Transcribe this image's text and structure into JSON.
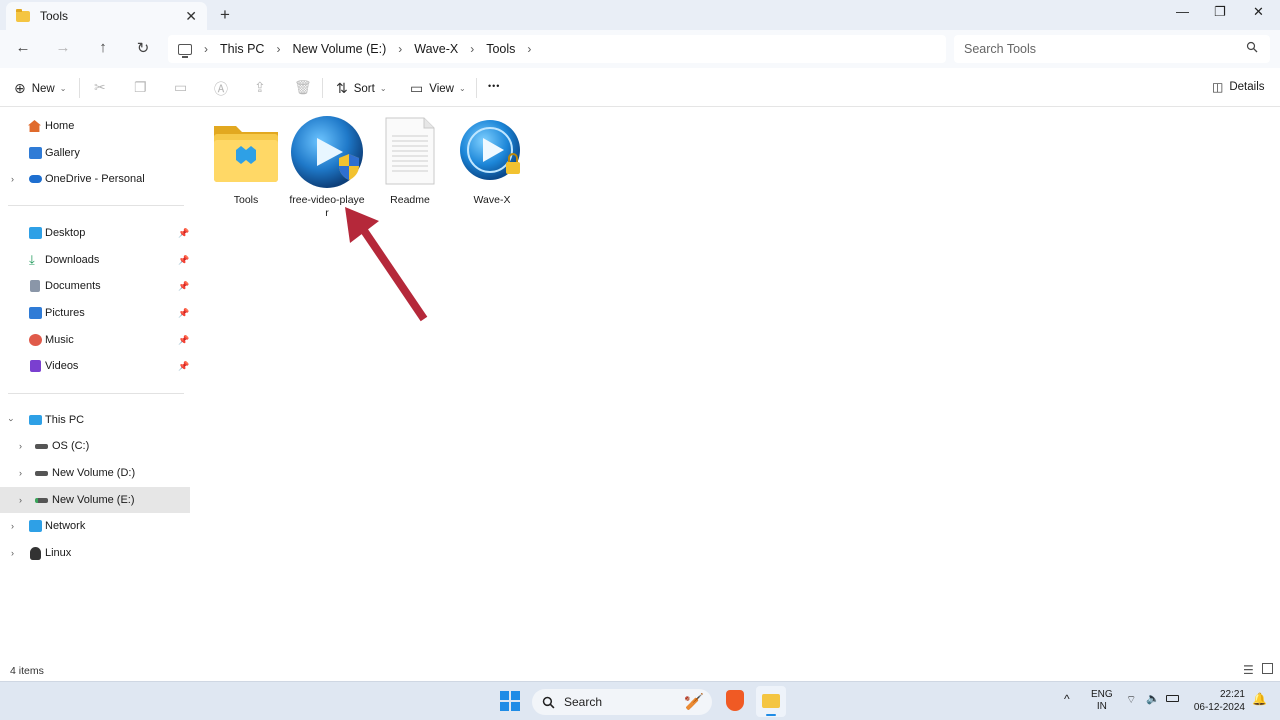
{
  "window": {
    "tab_title": "Tools",
    "tab_close": "✕",
    "new_tab": "+",
    "minimize": "—",
    "restore": "❐",
    "close": "✕"
  },
  "nav": {
    "back": "←",
    "forward": "→",
    "up": "↑",
    "refresh": "↻"
  },
  "breadcrumb": [
    "This PC",
    "New Volume (E:)",
    "Wave-X",
    "Tools"
  ],
  "search": {
    "placeholder": "Search Tools"
  },
  "commands": {
    "new_label": "New",
    "sort_label": "Sort",
    "view_label": "View",
    "more_label": "•••",
    "details_label": "Details",
    "disabled_icons": [
      "cut-icon",
      "copy-icon",
      "paste-icon",
      "rename-icon",
      "share-icon",
      "delete-icon"
    ]
  },
  "sidebar": {
    "quick": [
      {
        "label": "Home",
        "icon": "home-icon",
        "color": "#e06a2c"
      },
      {
        "label": "Gallery",
        "icon": "gallery-icon",
        "color": "#2f7bd6"
      },
      {
        "label": "OneDrive - Personal",
        "icon": "cloud-icon",
        "color": "#1e6fd0"
      }
    ],
    "pinned": [
      {
        "label": "Desktop",
        "icon": "desktop-icon",
        "color": "#2ea0e6"
      },
      {
        "label": "Downloads",
        "icon": "download-icon",
        "color": "#1f9a5b"
      },
      {
        "label": "Documents",
        "icon": "documents-icon",
        "color": "#8a96a8"
      },
      {
        "label": "Pictures",
        "icon": "pictures-icon",
        "color": "#2f7bd6"
      },
      {
        "label": "Music",
        "icon": "music-icon",
        "color": "#e05a4a"
      },
      {
        "label": "Videos",
        "icon": "videos-icon",
        "color": "#7a3fd0"
      }
    ],
    "tree": [
      {
        "label": "This PC",
        "icon": "pc-icon",
        "color": "#2ea0e6"
      },
      {
        "label": "OS (C:)",
        "icon": "drive-icon",
        "color": "#555555"
      },
      {
        "label": "New Volume (D:)",
        "icon": "drive-icon",
        "color": "#555555"
      },
      {
        "label": "New Volume (E:)",
        "icon": "drive-icon",
        "color": "#3aa55a"
      },
      {
        "label": "Network",
        "icon": "network-icon",
        "color": "#2ea0e6"
      },
      {
        "label": "Linux",
        "icon": "linux-icon",
        "color": "#333333"
      }
    ]
  },
  "files": [
    {
      "name": "Tools",
      "icon": "folder-icon"
    },
    {
      "name": "free-video-player",
      "icon": "video-player-shield-icon"
    },
    {
      "name": "Readme",
      "icon": "text-document-icon"
    },
    {
      "name": "Wave-X",
      "icon": "video-player-lock-icon"
    }
  ],
  "status": {
    "item_count": "4 items"
  },
  "taskbar": {
    "search_label": "Search",
    "lang_line1": "ENG",
    "lang_line2": "IN",
    "time": "22:21",
    "date": "06-12-2024"
  },
  "colors": {
    "accent": "#2f7bd6",
    "arrow": "#b5283a",
    "selected_bg": "#e6e6e6"
  }
}
